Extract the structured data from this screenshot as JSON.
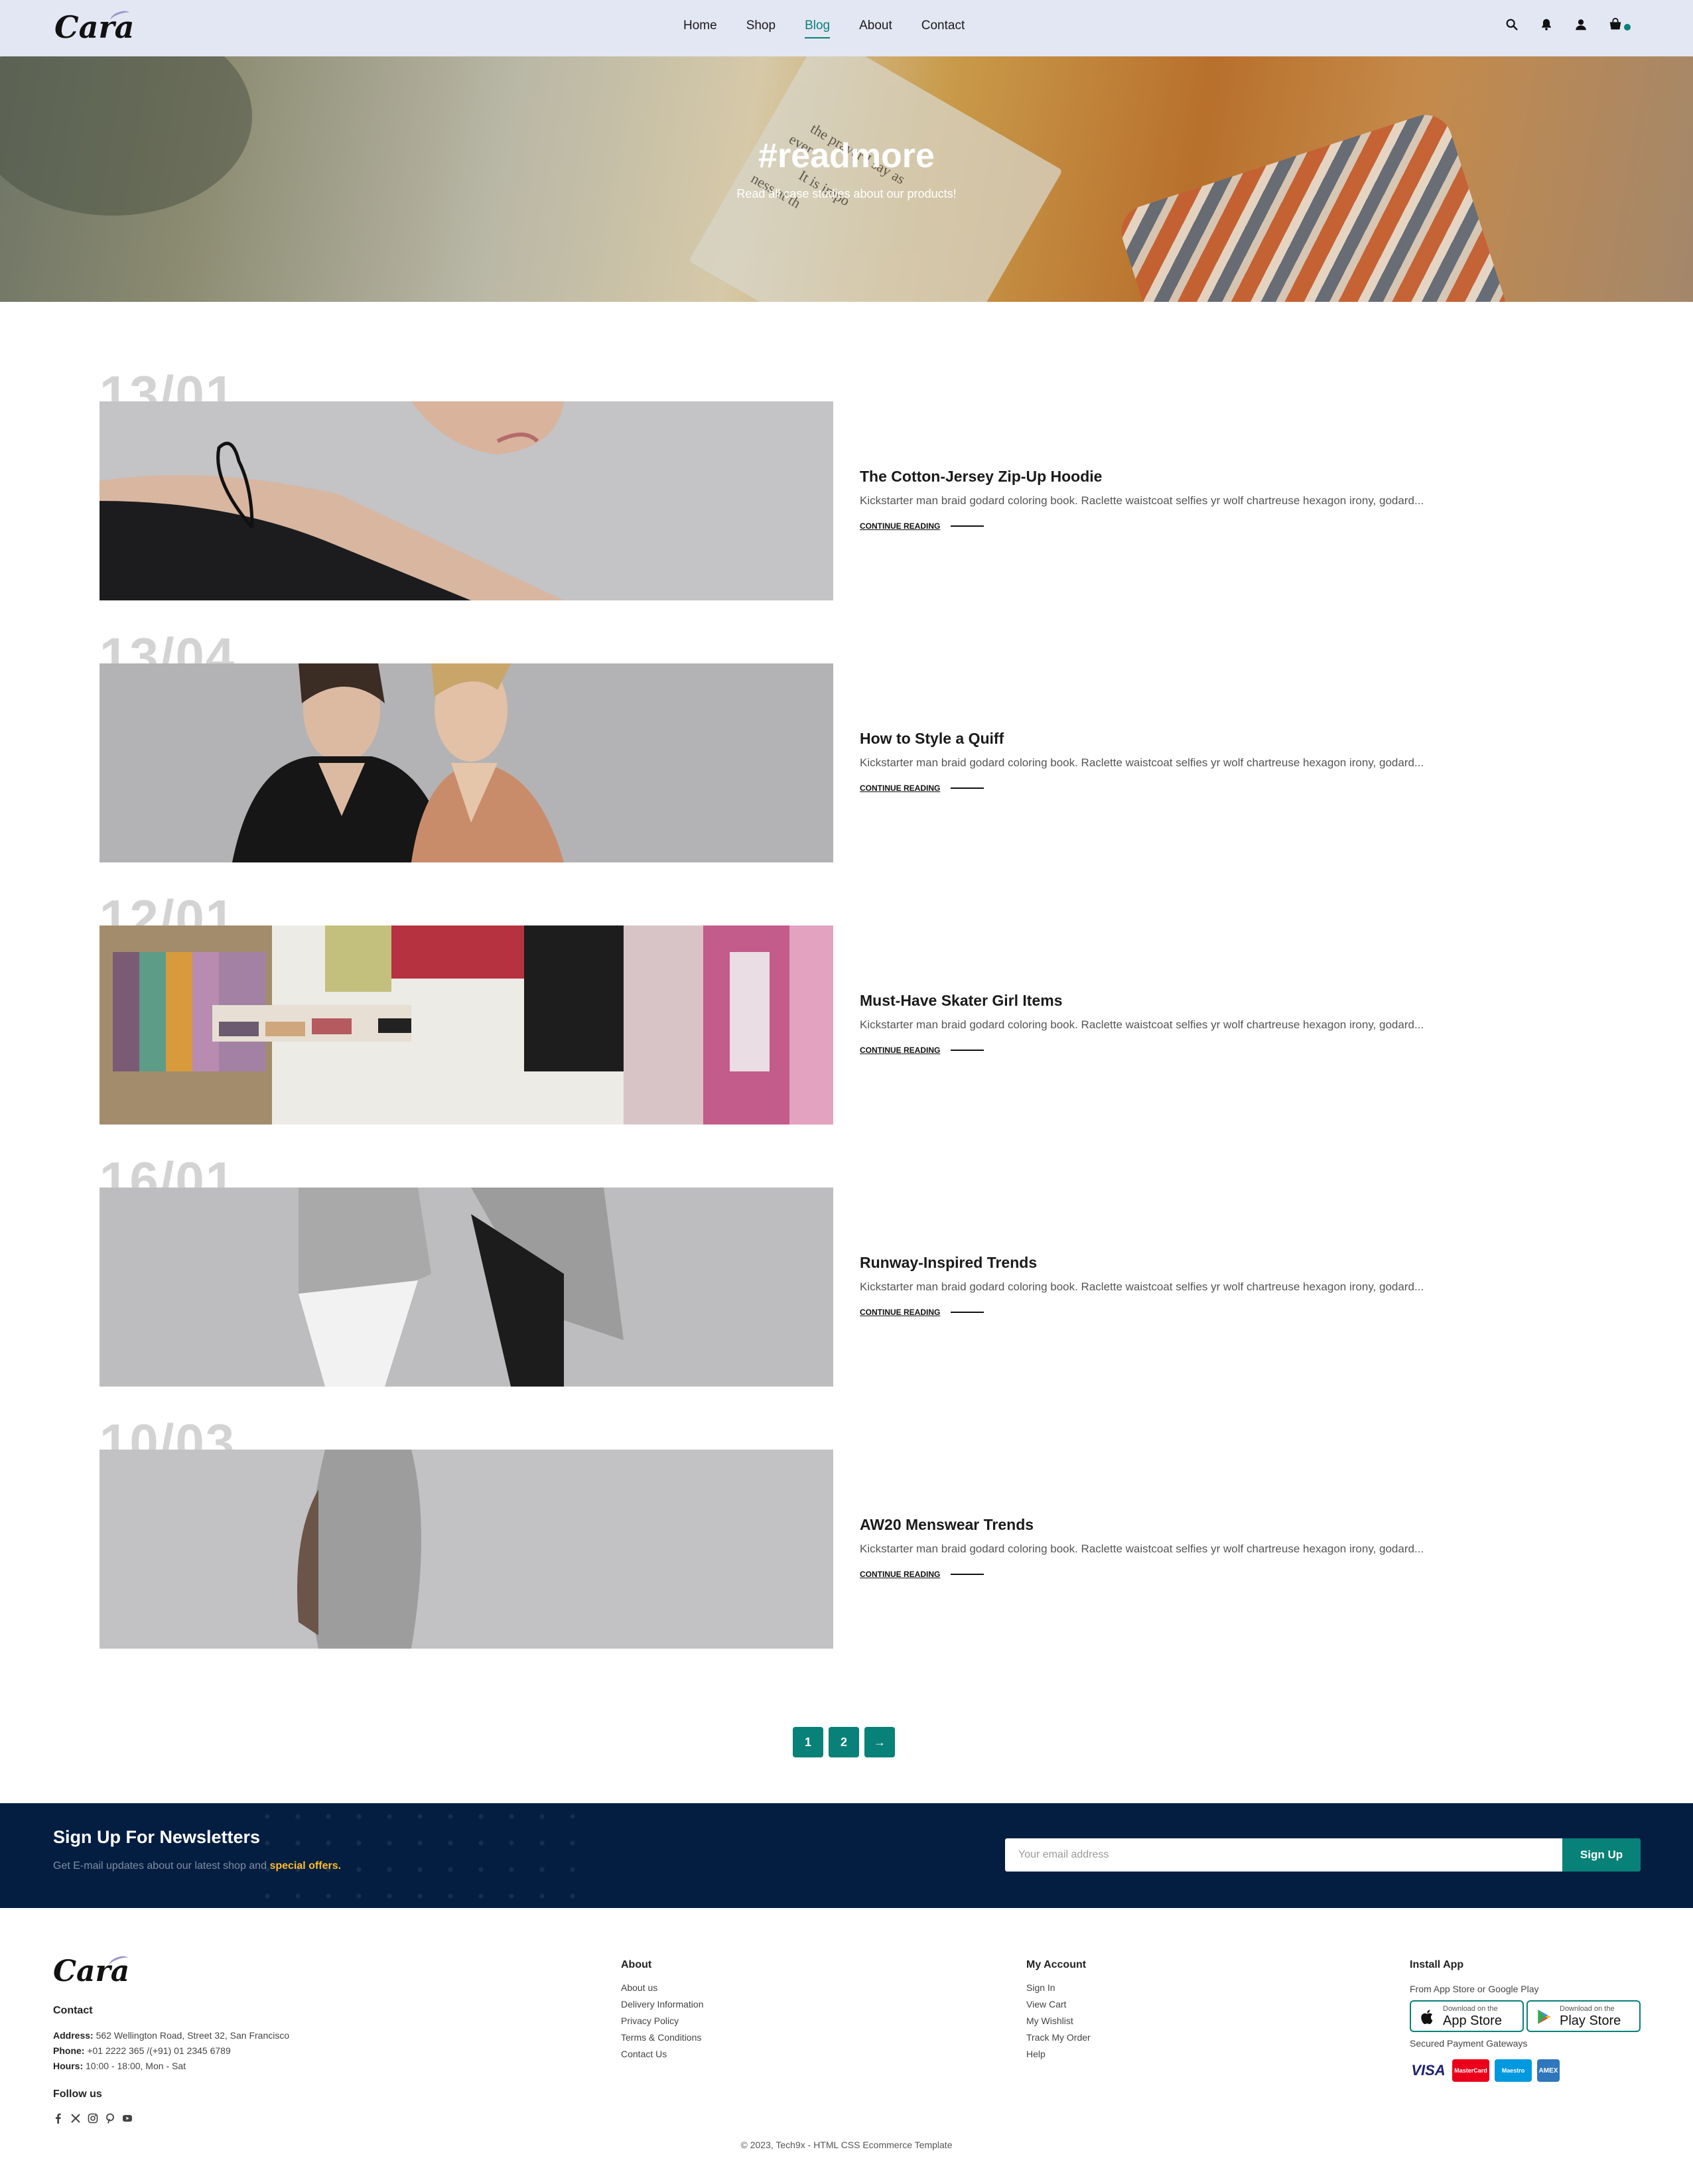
{
  "header": {
    "logo": "Cara",
    "nav": [
      {
        "label": "Home",
        "active": false
      },
      {
        "label": "Shop",
        "active": false
      },
      {
        "label": "Blog",
        "active": true
      },
      {
        "label": "About",
        "active": false
      },
      {
        "label": "Contact",
        "active": false
      }
    ],
    "icons": [
      "search-icon",
      "bell-icon",
      "user-icon",
      "cart-icon"
    ]
  },
  "hero": {
    "title": "#readmore",
    "subtitle": "Read all case studies about our products!"
  },
  "blogs": [
    {
      "date": "13/01",
      "title": "The Cotton-Jersey Zip-Up Hoodie",
      "desc": "Kickstarter man braid godard coloring book. Raclette waistcoat selfies yr wolf chartreuse hexagon irony, godard...",
      "link": "CONTINUE READING"
    },
    {
      "date": "13/04",
      "title": "How to Style a Quiff",
      "desc": "Kickstarter man braid godard coloring book. Raclette waistcoat selfies yr wolf chartreuse hexagon irony, godard...",
      "link": "CONTINUE READING"
    },
    {
      "date": "12/01",
      "title": "Must-Have Skater Girl Items",
      "desc": "Kickstarter man braid godard coloring book. Raclette waistcoat selfies yr wolf chartreuse hexagon irony, godard...",
      "link": "CONTINUE READING"
    },
    {
      "date": "16/01",
      "title": "Runway-Inspired Trends",
      "desc": "Kickstarter man braid godard coloring book. Raclette waistcoat selfies yr wolf chartreuse hexagon irony, godard...",
      "link": "CONTINUE READING"
    },
    {
      "date": "10/03",
      "title": "AW20 Menswear Trends",
      "desc": "Kickstarter man braid godard coloring book. Raclette waistcoat selfies yr wolf chartreuse hexagon irony, godard...",
      "link": "CONTINUE READING"
    }
  ],
  "pagination": [
    "1",
    "2",
    "→"
  ],
  "newsletter": {
    "title": "Sign Up For Newsletters",
    "subtitle": "Get E-mail updates about our latest shop and",
    "highlight": "special offers.",
    "placeholder": "Your email address",
    "button": "Sign Up"
  },
  "footer": {
    "logo": "Cara",
    "contact_heading": "Contact",
    "address_label": "Address:",
    "address": "562 Wellington Road, Street 32, San Francisco",
    "phone_label": "Phone:",
    "phone": "+01 2222 365 /(+91) 01 2345 6789",
    "hours_label": "Hours:",
    "hours": "10:00 - 18:00, Mon - Sat",
    "follow_heading": "Follow us",
    "social_icons": [
      "facebook-icon",
      "x-icon",
      "instagram-icon",
      "pinterest-icon",
      "youtube-icon"
    ],
    "about_heading": "About",
    "about_links": [
      "About us",
      "Delivery Information",
      "Privacy Policy",
      "Terms & Conditions",
      "Contact Us"
    ],
    "account_heading": "My Account",
    "account_links": [
      "Sign In",
      "View Cart",
      "My Wishlist",
      "Track My Order",
      "Help"
    ],
    "app_heading": "Install App",
    "app_sub": "From App Store or Google Play",
    "app_store_small": "Download on the",
    "app_store_big": "App Store",
    "play_store_small": "Download on the",
    "play_store_big": "Play Store",
    "payment_label": "Secured Payment Gateways",
    "cards": [
      "VISA",
      "MasterCard",
      "Maestro",
      "AMEX"
    ],
    "copyright": "© 2023, Tech9x - HTML CSS Ecommerce Template"
  },
  "colors": {
    "accent": "#088178",
    "header_bg": "#e3e6f3",
    "newsletter_bg": "#041e42",
    "highlight": "#ffbd27"
  }
}
